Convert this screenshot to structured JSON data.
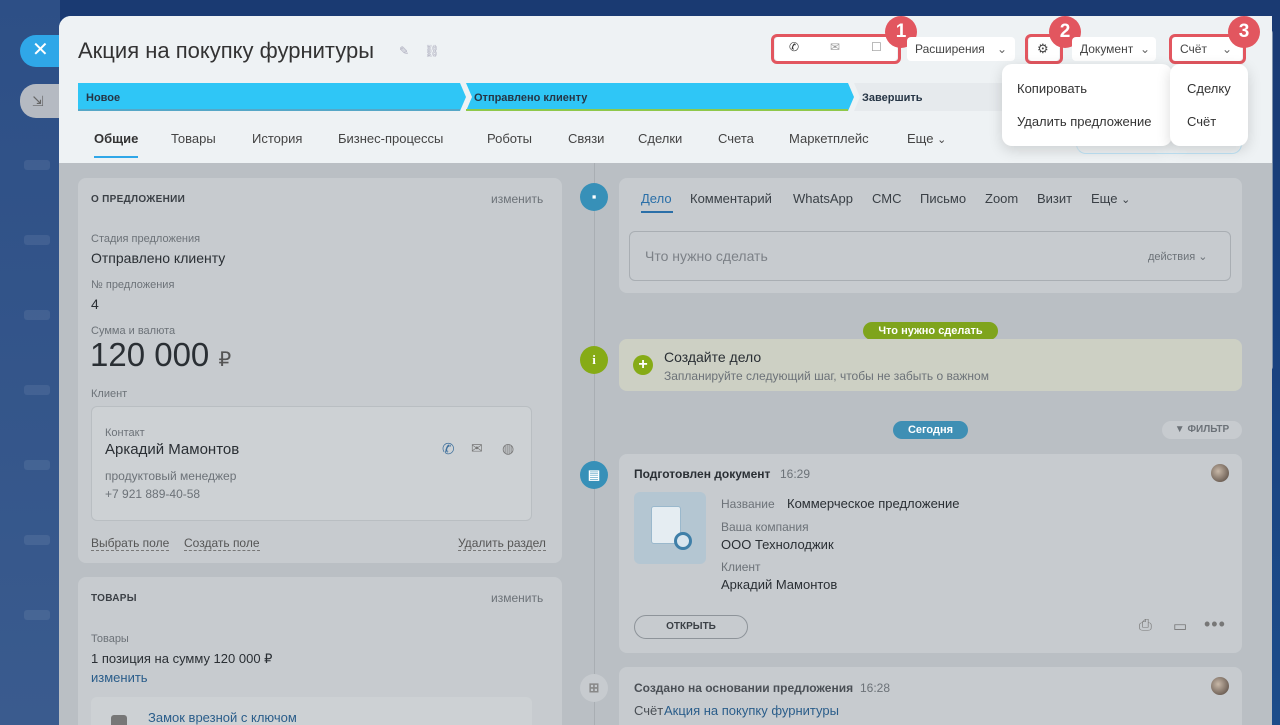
{
  "title": "Акция на покупку фурнитуры",
  "header": {
    "extensions_label": "Расширения",
    "document_label": "Документ",
    "invoice_label": "Счёт",
    "badges": [
      "1",
      "2",
      "3"
    ]
  },
  "stages": [
    "Новое",
    "Отправлено клиенту",
    "Завершить"
  ],
  "tabs": [
    "Общие",
    "Товары",
    "История",
    "Бизнес-процессы",
    "Роботы",
    "Связи",
    "Сделки",
    "Счета",
    "Маркетплейс",
    "Еще"
  ],
  "settings_menu": [
    "Копировать",
    "Удалить предложение"
  ],
  "invoice_menu": [
    "Сделку",
    "Счёт"
  ],
  "about": {
    "title": "О ПРЕДЛОЖЕНИИ",
    "edit": "изменить",
    "stage_label": "Стадия предложения",
    "stage_value": "Отправлено клиенту",
    "number_label": "№ предложения",
    "number_value": "4",
    "sum_label": "Сумма и валюта",
    "sum_value": "120 000",
    "currency": "₽",
    "client_label": "Клиент",
    "contact_label": "Контакт",
    "contact_name": "Аркадий Мамонтов",
    "contact_role": "продуктовый менеджер",
    "contact_phone": "+7 921 889-40-58",
    "select_field": "Выбрать поле",
    "create_field": "Создать поле",
    "delete_section": "Удалить раздел"
  },
  "goods": {
    "title": "ТОВАРЫ",
    "edit": "изменить",
    "label": "Товары",
    "summary": "1 позиция на сумму 120 000 ₽",
    "change": "изменить",
    "item": "Замок врезной с ключом"
  },
  "activity": {
    "tabs": [
      "Дело",
      "Комментарий",
      "WhatsApp",
      "СМС",
      "Письмо",
      "Zoom",
      "Визит",
      "Еще"
    ],
    "placeholder": "Что нужно сделать",
    "actions": "действия",
    "todo_pill": "Что нужно сделать",
    "create_title": "Создайте дело",
    "create_sub": "Запланируйте следующий шаг, чтобы не забыть о важном",
    "today_pill": "Сегодня",
    "filter": "ФИЛЬТР"
  },
  "doc_card": {
    "title": "Подготовлен документ",
    "time": "16:29",
    "name_label": "Название",
    "name_value": "Коммерческое предложение",
    "company_label": "Ваша компания",
    "company_value": "ООО Технолоджик",
    "client_label": "Клиент",
    "client_value": "Аркадий Мамонтов",
    "open": "ОТКРЫТЬ"
  },
  "created_card": {
    "title": "Создано на основании предложения",
    "time": "16:28",
    "prefix": "Счёт",
    "link": "Акция на покупку фурнитуры"
  },
  "colors": {
    "accent": "#2fa7e8",
    "stage_blue": "#2fc6f6",
    "stage_done": "#2fc6f6",
    "highlight": "#e2565f",
    "green": "#9dcf00"
  }
}
